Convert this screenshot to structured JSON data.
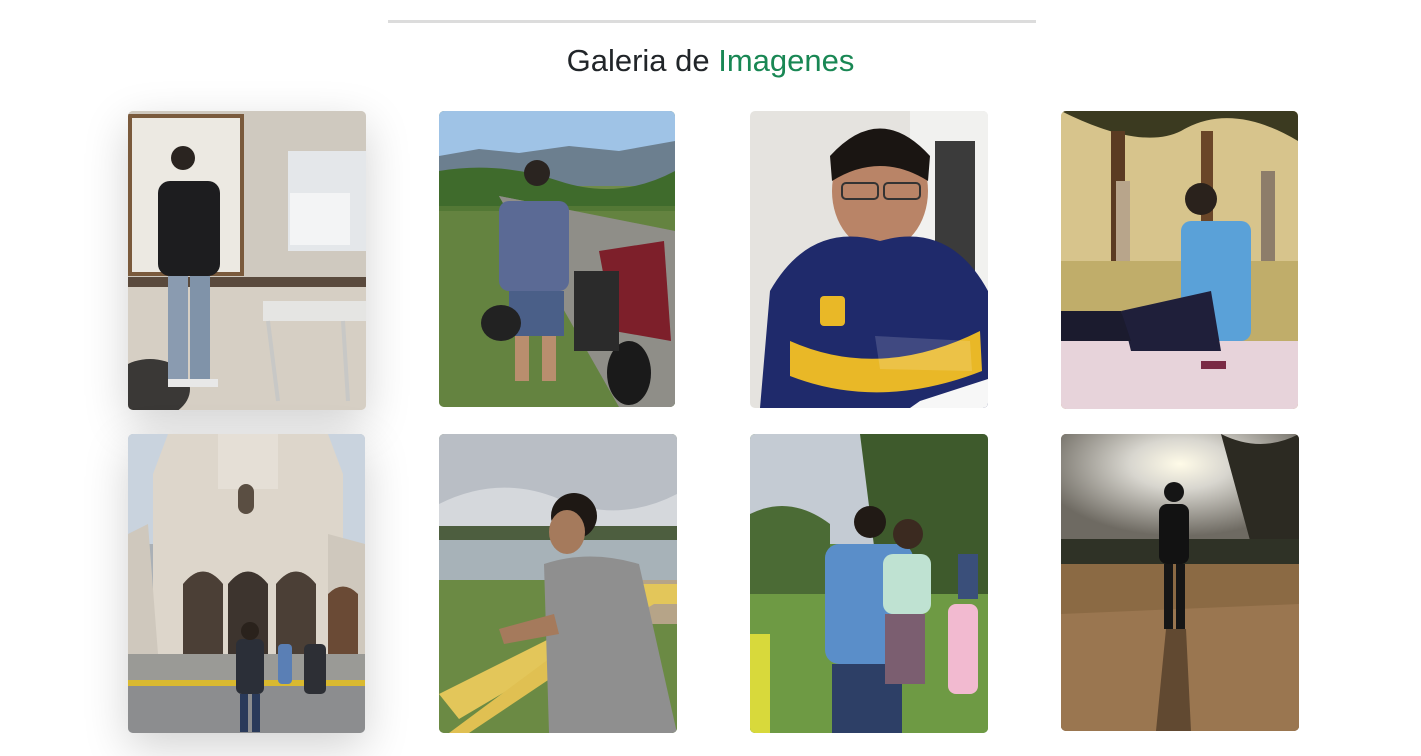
{
  "gallery": {
    "title_prefix": "Galeria de",
    "title_accent": "Imagenes",
    "accent_color": "#198754"
  },
  "photos": [
    {
      "id": "photo-1"
    },
    {
      "id": "photo-2"
    },
    {
      "id": "photo-3"
    },
    {
      "id": "photo-4"
    },
    {
      "id": "photo-5"
    },
    {
      "id": "photo-6"
    },
    {
      "id": "photo-7"
    },
    {
      "id": "photo-8"
    }
  ]
}
